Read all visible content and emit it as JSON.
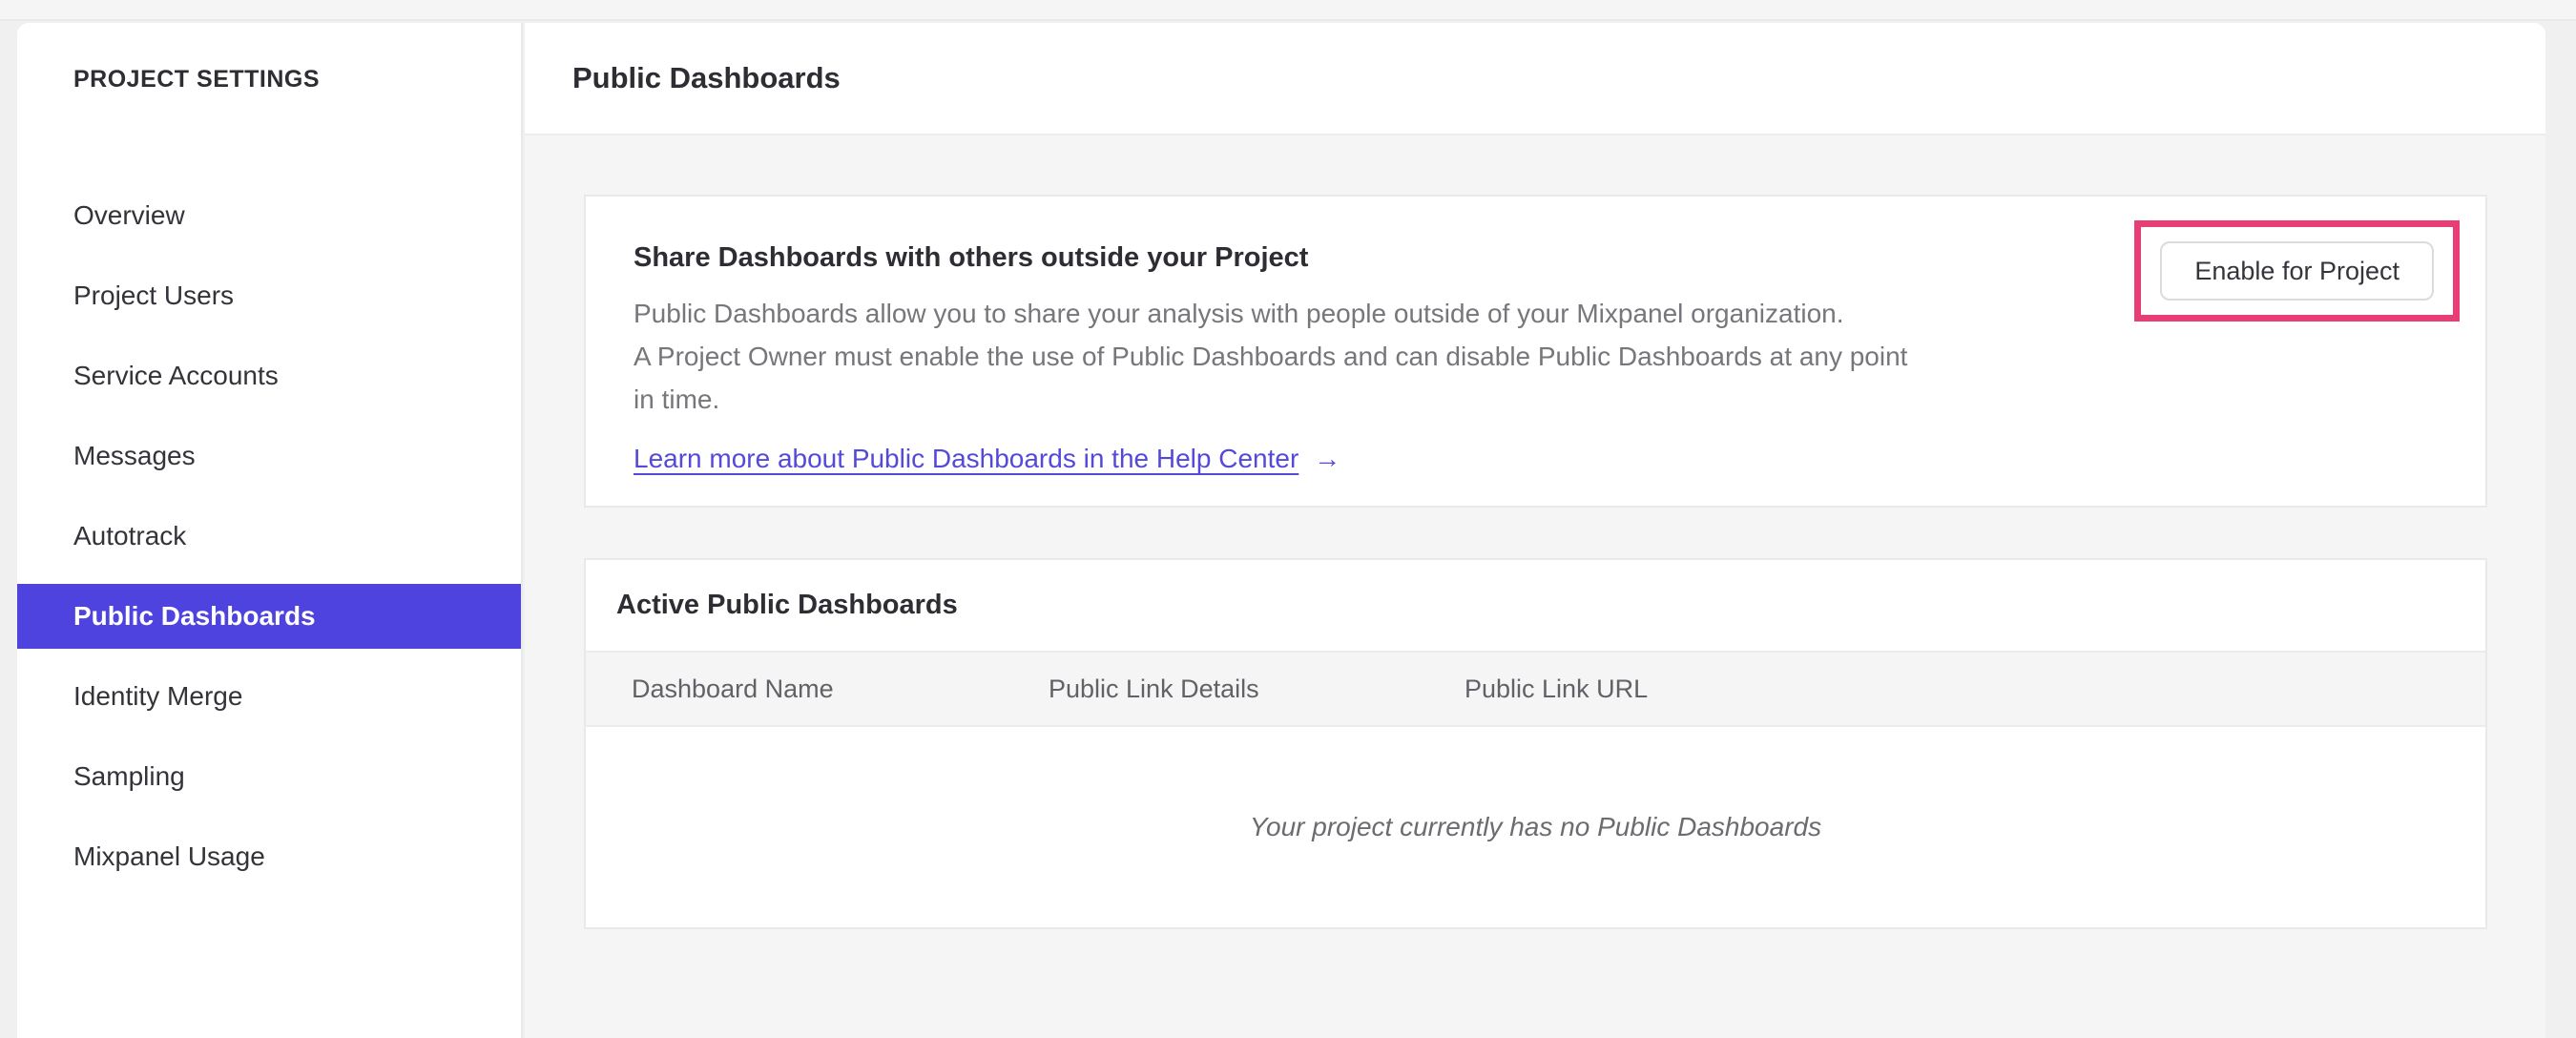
{
  "sidebar": {
    "title": "PROJECT SETTINGS",
    "items": [
      {
        "label": "Overview",
        "selected": false
      },
      {
        "label": "Project Users",
        "selected": false
      },
      {
        "label": "Service Accounts",
        "selected": false
      },
      {
        "label": "Messages",
        "selected": false
      },
      {
        "label": "Autotrack",
        "selected": false
      },
      {
        "label": "Public Dashboards",
        "selected": true
      },
      {
        "label": "Identity Merge",
        "selected": false
      },
      {
        "label": "Sampling",
        "selected": false
      },
      {
        "label": "Mixpanel Usage",
        "selected": false
      }
    ]
  },
  "header": {
    "title": "Public Dashboards"
  },
  "share_card": {
    "heading": "Share Dashboards with others outside your Project",
    "description_lines": [
      "Public Dashboards allow you to share your analysis with people outside of your Mixpanel organization.",
      "A Project Owner must enable the use of Public Dashboards and can disable Public Dashboards at any point",
      "in time."
    ],
    "link_label": "Learn more about Public Dashboards in the Help Center",
    "link_arrow": "→",
    "enable_button_label": "Enable for Project"
  },
  "active_card": {
    "title": "Active Public Dashboards",
    "columns": [
      "Dashboard Name",
      "Public Link Details",
      "Public Link URL"
    ],
    "empty_message": "Your project currently has no Public Dashboards"
  },
  "colors": {
    "selected_nav_purple": "#4f43e0",
    "link_purple": "#5449d9",
    "highlight_pink": "#e83e75",
    "page_background": "#f0f0f1",
    "panel_body_background": "#f5f5f6"
  }
}
